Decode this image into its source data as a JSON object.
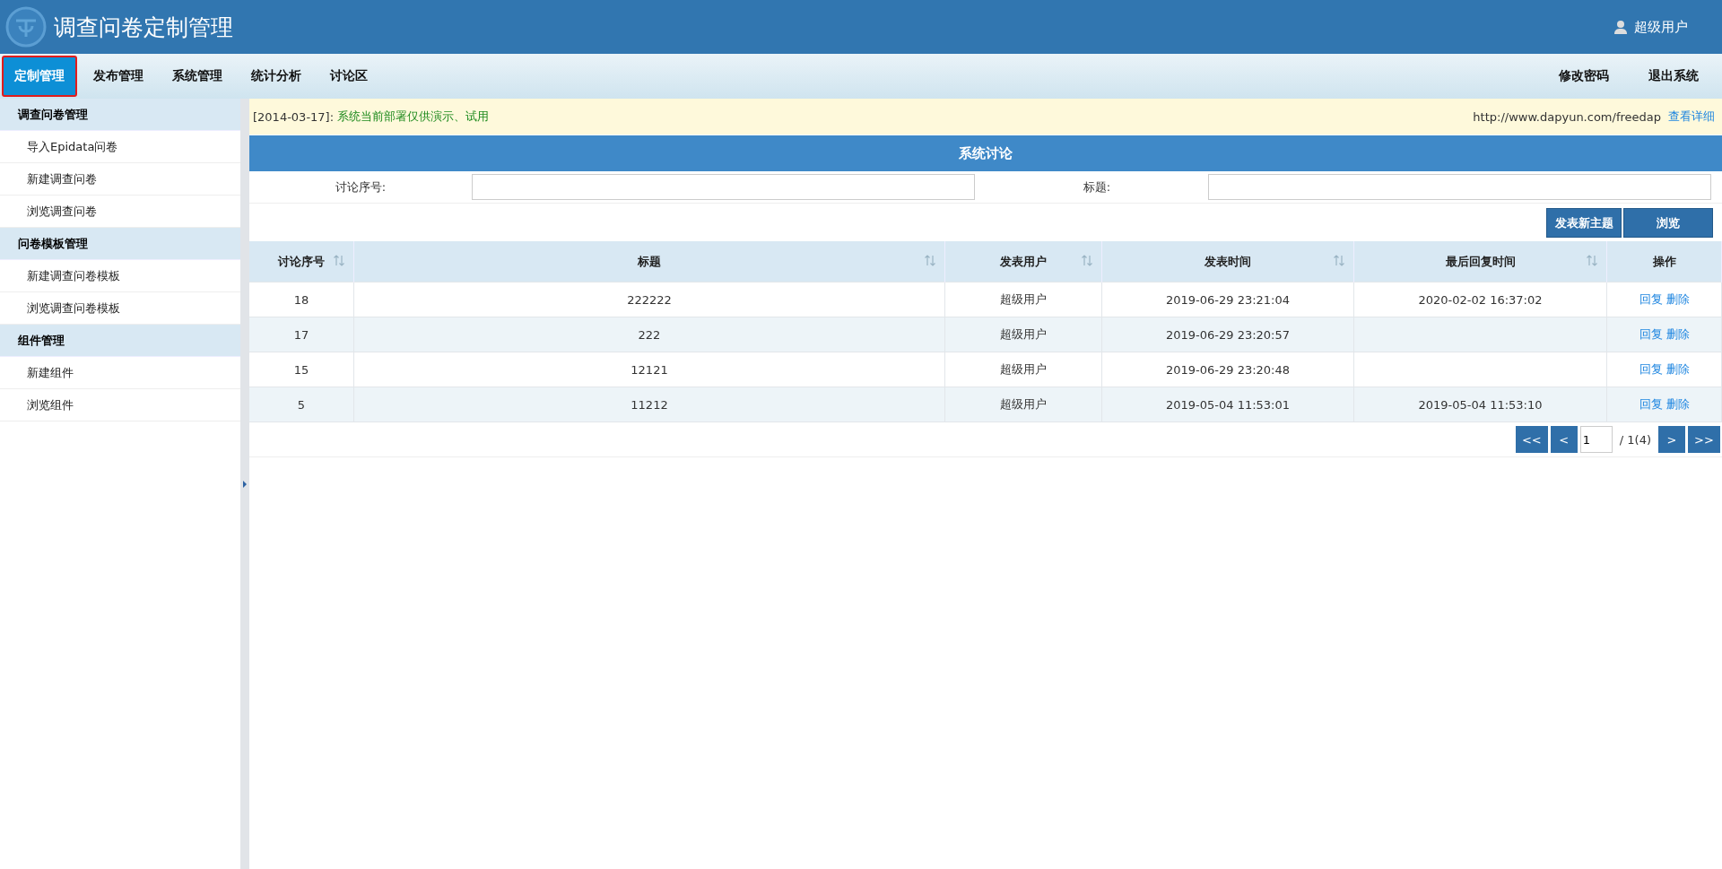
{
  "header": {
    "title": "调查问卷定制管理",
    "user": "超级用户"
  },
  "nav": {
    "tabs": [
      {
        "label": "定制管理",
        "selected": true
      },
      {
        "label": "发布管理",
        "selected": false
      },
      {
        "label": "系统管理",
        "selected": false
      },
      {
        "label": "统计分析",
        "selected": false
      },
      {
        "label": "讨论区",
        "selected": false
      }
    ],
    "right_links": [
      "修改密码",
      "退出系统"
    ]
  },
  "sidebar": {
    "groups": [
      {
        "title": "调查问卷管理",
        "items": [
          "导入Epidata问卷",
          "新建调查问卷",
          "浏览调查问卷"
        ]
      },
      {
        "title": "问卷模板管理",
        "items": [
          "新建调查问卷模板",
          "浏览调查问卷模板"
        ]
      },
      {
        "title": "组件管理",
        "items": [
          "新建组件",
          "浏览组件"
        ]
      }
    ]
  },
  "notice": {
    "date": "[2014-03-17]:",
    "message": "系统当前部署仅供演示、试用",
    "url": "http://www.dapyun.com/freedap",
    "link": "查看详细"
  },
  "panel": {
    "title": "系统讨论",
    "filters": [
      {
        "label": "讨论序号:"
      },
      {
        "label": "标题:"
      }
    ],
    "buttons": [
      "发表新主题",
      "浏览"
    ]
  },
  "table": {
    "columns": [
      {
        "label": "讨论序号",
        "sortable": true
      },
      {
        "label": "标题",
        "sortable": true
      },
      {
        "label": "发表用户",
        "sortable": true
      },
      {
        "label": "发表时间",
        "sortable": true
      },
      {
        "label": "最后回复时间",
        "sortable": true
      },
      {
        "label": "操作",
        "sortable": false
      }
    ],
    "rows": [
      {
        "cells": [
          "18",
          "222222",
          "超级用户",
          "2019-06-29 23:21:04",
          "2020-02-02 16:37:02"
        ],
        "actions": [
          "回复",
          "删除"
        ]
      },
      {
        "cells": [
          "17",
          "222",
          "超级用户",
          "2019-06-29 23:20:57",
          ""
        ],
        "actions": [
          "回复",
          "删除"
        ]
      },
      {
        "cells": [
          "15",
          "12121",
          "超级用户",
          "2019-06-29 23:20:48",
          ""
        ],
        "actions": [
          "回复",
          "删除"
        ]
      },
      {
        "cells": [
          "5",
          "11212",
          "超级用户",
          "2019-05-04 11:53:01",
          "2019-05-04 11:53:10"
        ],
        "actions": [
          "回复",
          "删除"
        ]
      }
    ]
  },
  "pagination": {
    "first": "<<",
    "prev": "<",
    "page": "1",
    "total": "/ 1(4)",
    "next": ">",
    "last": ">>"
  }
}
